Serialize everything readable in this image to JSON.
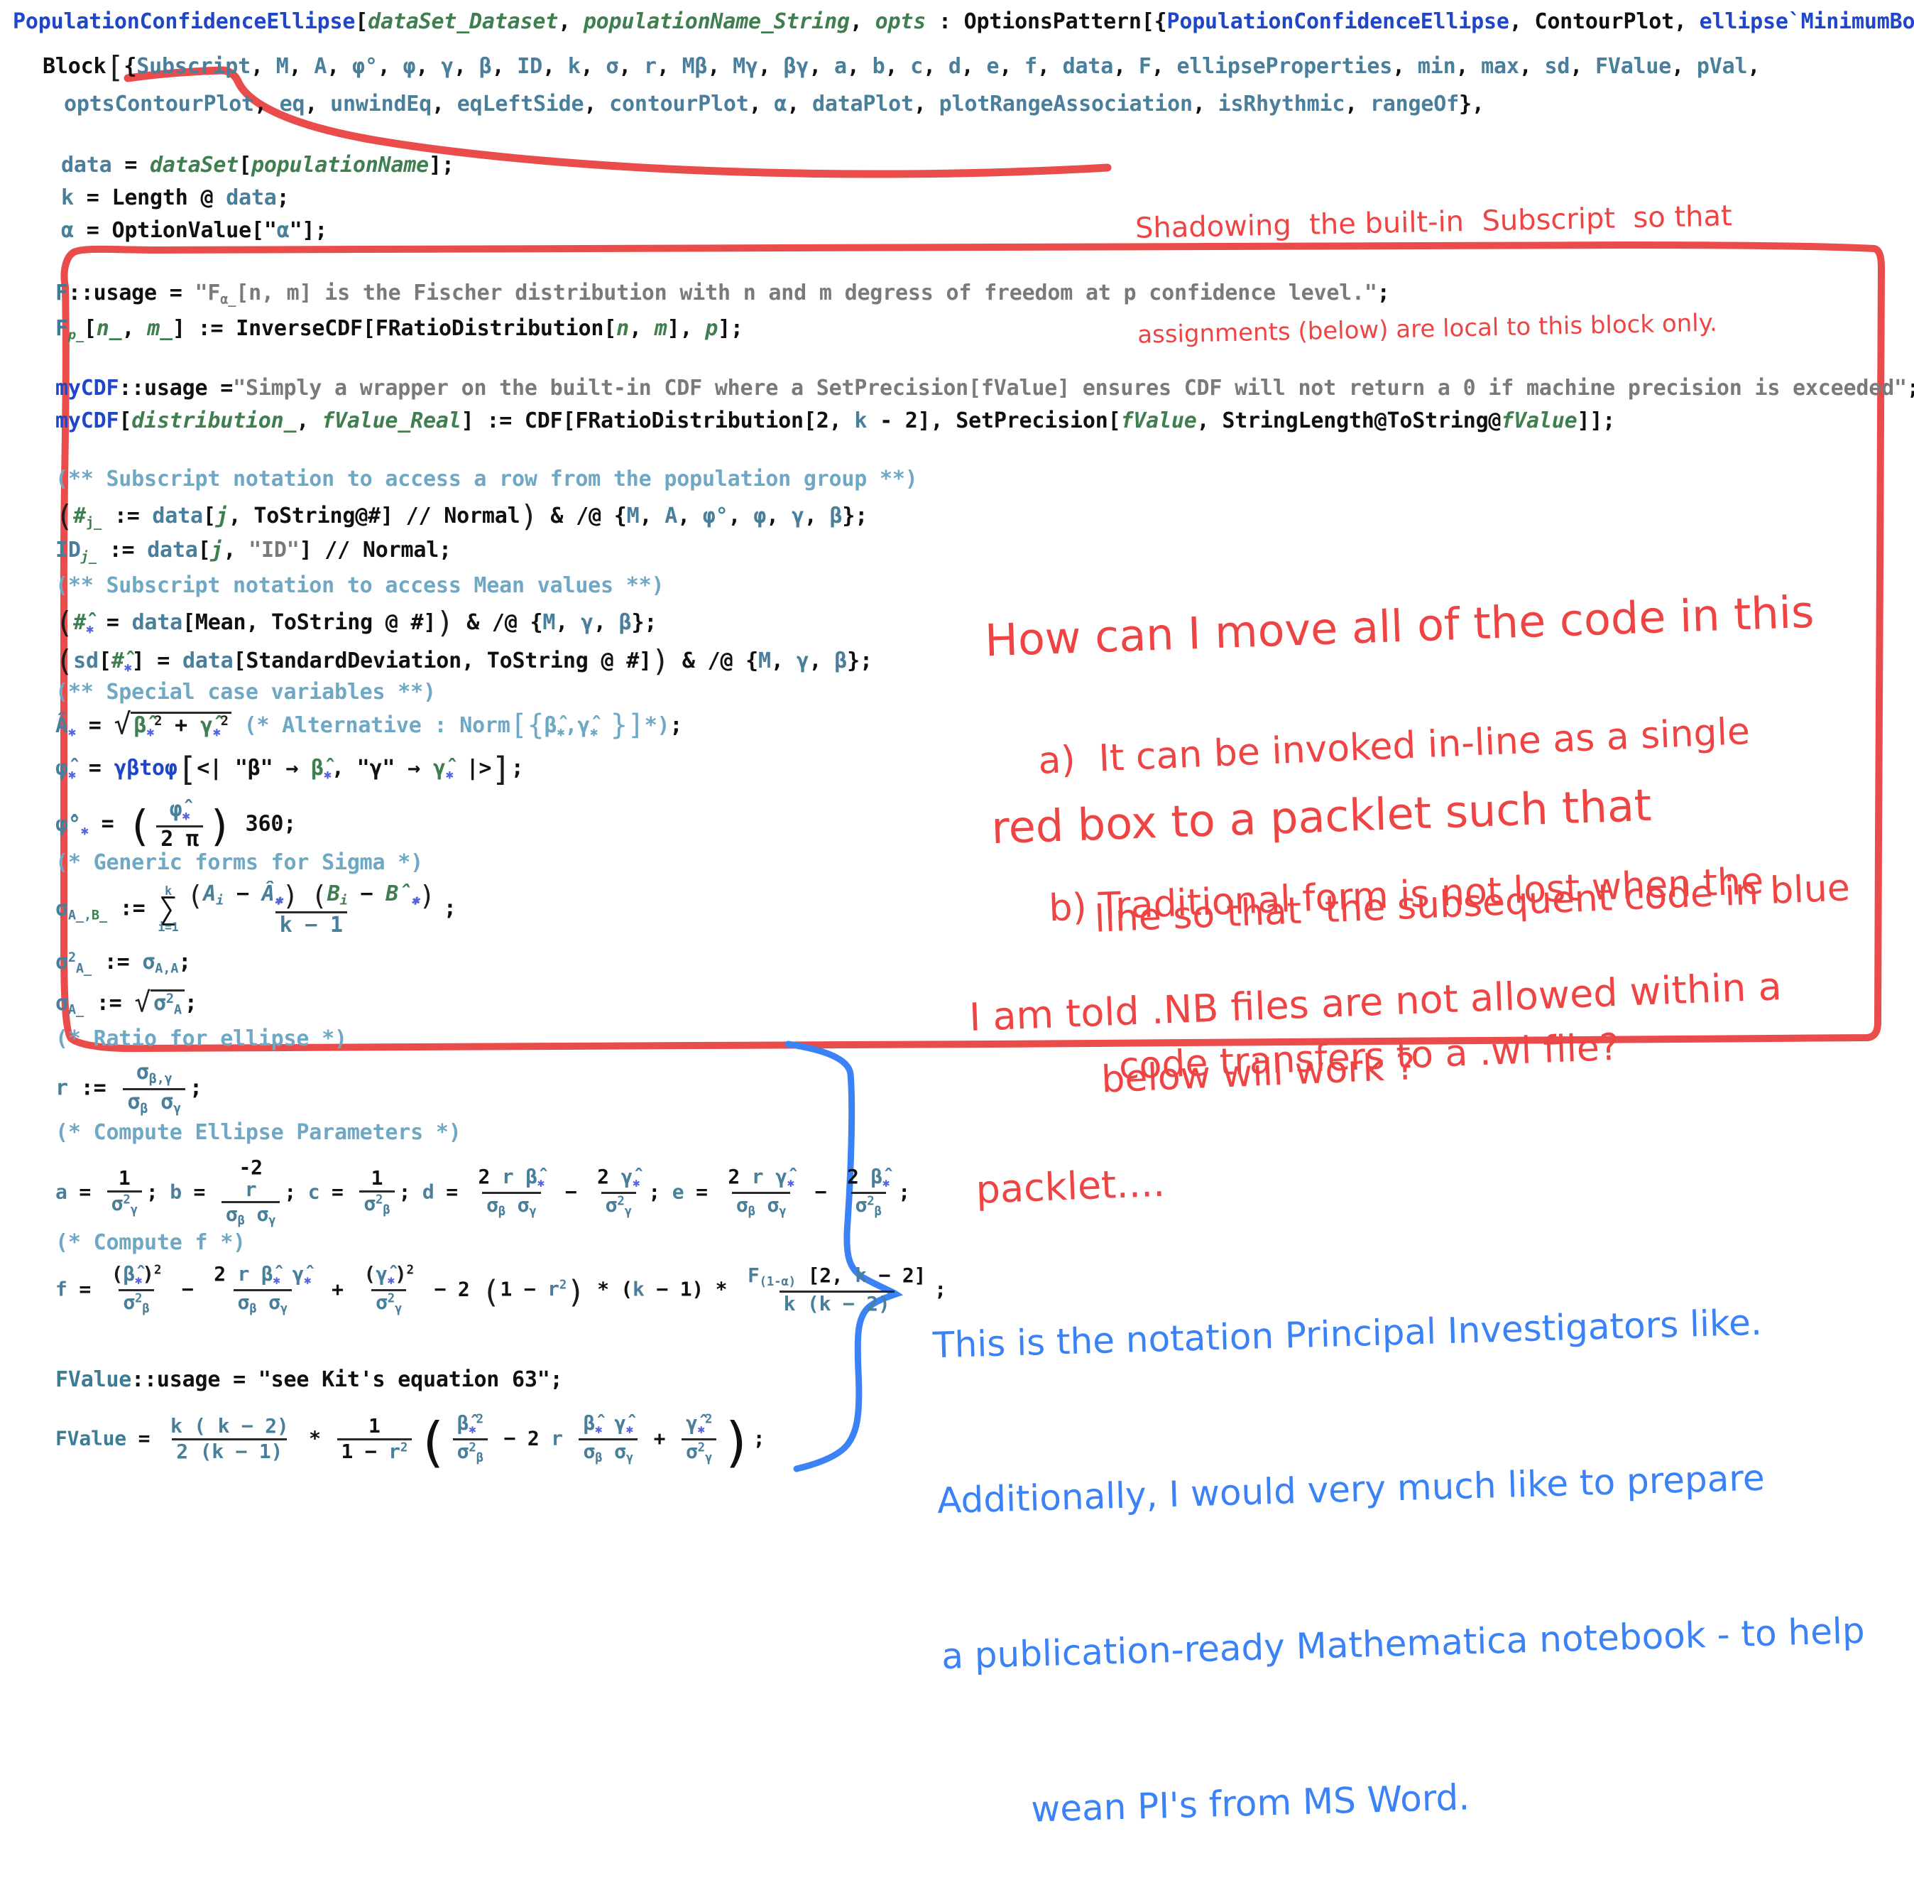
{
  "document": {
    "kind": "mathematica-notebook-screenshot-with-handwritten-annotations",
    "background": "#ffffff"
  },
  "colors": {
    "red_ink": "#ef4444",
    "blue_ink": "#3b82f6",
    "symbol_blue": "#1f46c8",
    "local_var": "#4a7f9c",
    "pattern_green": "#3f7f4f",
    "comment_blue": "#6fa8c4",
    "string_gray": "#7a7a7a"
  },
  "code": {
    "signature_line1": "PopulationConfidenceEllipse[dataSet_Dataset, populationName_String, opts : OptionsPattern[{PopulationConfidenceEllipse, ContourPlot, ellipse`MinimumBoundingSquare}]] :=",
    "signature_line2": "Block[{Subscript, M, A, ϕ°, ϕ, γ, β, ID, k, σ, r, Mβ, Mγ, βγ, a, b, c, d, e, f, data, F, ellipseProperties, min, max, sd, FValue, pVal,",
    "signature_line3": "optsContourPlot, eq, unwindEq, eqLeftSide, contourPlot, α, dataPlot, plotRangeAssociation, isRhythmic, rangeOf},",
    "assign_data": "data = dataSet[populationName];",
    "assign_k": "k = Length @ data;",
    "assign_alpha": "α = OptionValue[\"α\"];",
    "f_usage": "F::usage = \"Fα_[n, m] is the Fischer distribution with n and m degress of freedom at p confidence level.\";",
    "f_def": "Fp_[n_, m_] := InverseCDF[FRatioDistribution[n, m], p];",
    "mycdf_usage": "myCDF::usage =\"Simply a wrapper on the built-in CDF where a SetPrecision[fValue] ensures CDF will not return a 0 if machine precision is exceeded\";",
    "mycdf_def": "myCDF[distribution_, fValue_Real] := CDF[FRatioDistribution[2, k - 2], SetPrecision[fValue, StringLength@ToString@fValue]];",
    "comment_subscript_row": "(** Subscript notation to access a row from the population group **)",
    "row_def": "(#j_ := data[j, ToString@#] // Normal) & /@ {M, A, ϕ°, ϕ, γ, β};",
    "id_def": "IDj_ := data[j, \"ID\"] // Normal;",
    "comment_subscript_mean": "(** Subscript notation to access Mean values **)",
    "mean_def": "(#̂* = data[Mean, ToString @ #]) & /@ {M, γ, β};",
    "sd_def": "(sd[#̂*] = data[StandardDeviation, ToString @ #]) & /@ {M, γ, β};",
    "comment_special": "(** Special case variables **)",
    "a_hat_def": "Â* = Sqrt[β̂*^2 + γ̂*^2] (* Alternative : Norm[{β̂*,γ̂*}] *);",
    "phi_hat_def": "ϕ̂* = γβtoϕ[<| \"β\" → β̂*, \"γ\" → γ̂* |>];",
    "phi_deg_def": "ϕ°̂* = (ϕ̂* / (2 π)) 360;",
    "comment_sigma": "(* Generic forms for Sigma *)",
    "sigma_generic": "σA_,B_ := Sum[(Ai - Â*)(Bi - B̂*)/(k - 1), {i, 1, k}];",
    "sigma_sq": "σ²A_ := σA,A;",
    "sigma_def": "σA_ := Sqrt[σ²A];",
    "comment_ratio": "(* Ratio for ellipse *)",
    "r_def": "r := σβ,γ / (σβ σγ);",
    "comment_ellipse_params": "(* Compute Ellipse Parameters *)",
    "ellipse_params": "a = 1/σ²γ; b = -2 r/(σβ σγ); c = 1/σ²β; d = 2 r β̂*/(σβ σγ) - 2 γ̂*/σ²γ; e = 2 r γ̂*/(σβ σγ) - 2 β̂*/σ²β;",
    "comment_compute_f": "(* Compute f  *)",
    "f_formula": "f = (β̂*)²/σ²β - 2 r β̂* γ̂*/(σβ σγ) + (γ̂*)²/σ²γ - 2 (1 - r²) * (k - 1) * F(1-α)[2, k - 2]/(k (k - 2));",
    "fvalue_usage": "FValue::usage = \"see Kit's equation 63\";",
    "fvalue_formula": "FValue = k (k - 2)/(2 (k - 1)) * 1/(1 - r²) (β̂*²/σ²β - 2 r β̂* γ̂*/(σβ σγ) + γ̂*²/σ²γ);"
  },
  "annotations": {
    "red_note_shadowing": {
      "lines": [
        "Shadowing  the built-in  Subscript  so that",
        "assignments (below) are local to this block only."
      ]
    },
    "red_note_question": {
      "lines": [
        "How can I move all of the code in this",
        "red box to a packlet such that",
        "a)  It can be invoked in-line as a single",
        "line so that  the subsequent code in blue",
        "below will work ?",
        "b) Traditional form is not lost when the",
        "code transfers to a .wl file?",
        "I am told .NB files are not allowed within a",
        "packlet...."
      ]
    },
    "blue_note": {
      "lines": [
        "This is the notation Principal Investigators like.",
        "Additionally, I would very much like to prepare",
        "a publication-ready Mathematica notebook - to help",
        "wean PI's from MS Word."
      ]
    },
    "shapes": {
      "red_box_label": "red-highlight-box",
      "red_arrow_label": "red-arrow-to-subscript",
      "blue_brace_label": "blue-curly-brace"
    }
  }
}
